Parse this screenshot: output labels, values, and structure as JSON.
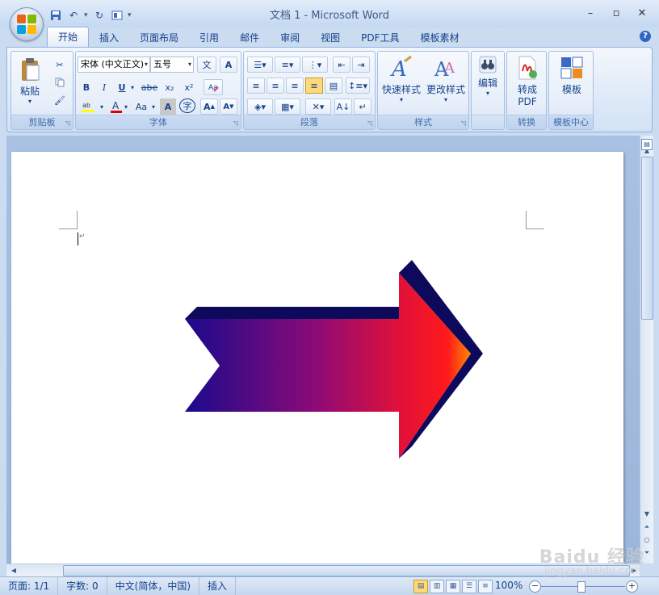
{
  "window": {
    "title": "文档 1 - Microsoft Word"
  },
  "tabs": [
    "开始",
    "插入",
    "页面布局",
    "引用",
    "邮件",
    "审阅",
    "视图",
    "PDF工具",
    "模板素材"
  ],
  "active_tab": "开始",
  "ribbon": {
    "clipboard": {
      "label": "剪贴板",
      "paste": "粘贴"
    },
    "font": {
      "label": "字体",
      "font_name": "宋体 (中文正文)",
      "font_size": "五号",
      "bold": "B",
      "italic": "I",
      "underline": "U",
      "strike": "abe",
      "subscript": "x₂",
      "superscript": "x²",
      "change_case": "Aa",
      "char_shading": "A",
      "enclose": "字",
      "grow": "A",
      "shrink": "A"
    },
    "paragraph": {
      "label": "段落"
    },
    "styles": {
      "label": "样式",
      "quick_styles": "快速样式",
      "change_styles": "更改样式"
    },
    "editing": {
      "edit": "编辑"
    },
    "convert": {
      "label": "转换",
      "to_pdf_line1": "转成",
      "to_pdf_line2": "PDF"
    },
    "templates": {
      "label": "模板中心",
      "template": "模板"
    }
  },
  "document": {
    "shape": "right-arrow",
    "gradient": [
      "#1a0a8c",
      "#8a0a78",
      "#e0103a",
      "#ff1a1a",
      "#ff8a00"
    ],
    "shadow_color": "#0d0a5c"
  },
  "statusbar": {
    "page": "页面: 1/1",
    "words": "字数: 0",
    "language": "中文(简体，中国)",
    "mode": "插入",
    "zoom": "100%"
  },
  "watermark": {
    "text": "Baidu 经验",
    "url": "jingyan.baidu.com"
  }
}
